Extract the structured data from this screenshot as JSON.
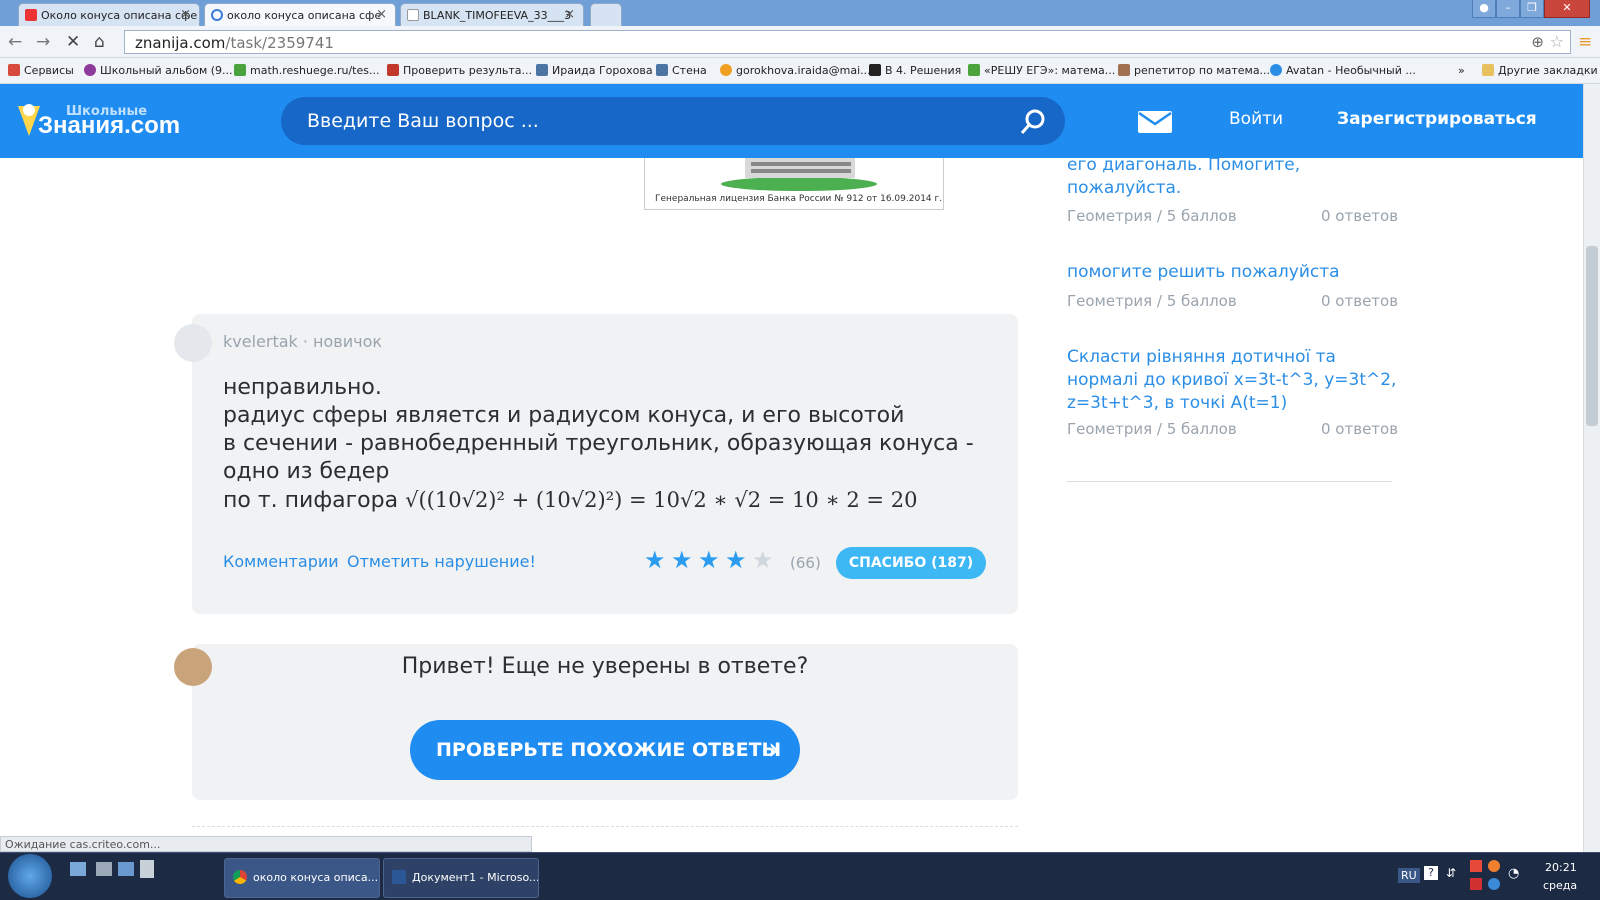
{
  "browser": {
    "tabs": [
      {
        "title": "Около конуса описана сфе"
      },
      {
        "title": "около конуса описана сфе"
      },
      {
        "title": "BLANK_TIMOFEEVA_33___3"
      }
    ],
    "close_glyph": "×",
    "url_domain": "znanija.com",
    "url_path": "/task/2359741",
    "bookmarks": [
      {
        "label": "Сервисы",
        "color": "#d64b3c"
      },
      {
        "label": "Школьный альбом (9...",
        "color": "#8e3a9a"
      },
      {
        "label": "math.reshuege.ru/tes...",
        "color": "#4aa33c"
      },
      {
        "label": "Проверить результа...",
        "color": "#c0392b"
      },
      {
        "label": "Ираида Горохова",
        "color": "#4c75a3"
      },
      {
        "label": "Стена",
        "color": "#4c75a3"
      },
      {
        "label": "gorokhova.iraida@mai...",
        "color": "#f0a020"
      },
      {
        "label": "В 4. Решения",
        "color": "#222222"
      },
      {
        "label": "«РЕШУ ЕГЭ»: матема...",
        "color": "#4aa33c"
      },
      {
        "label": "репетитор по матема...",
        "color": "#a07050"
      },
      {
        "label": "Avatan - Необычный ...",
        "color": "#2b8ee6"
      }
    ],
    "bookmarks_overflow": "»",
    "other_bookmarks": "Другие закладки",
    "status": "Ожидание cas.criteo.com..."
  },
  "site": {
    "logo_top": "Школьные",
    "logo_main": "Знания.com",
    "search_placeholder": "Введите Ваш вопрос ...",
    "login": "Войти",
    "register": "Зарегистрироваться",
    "ad_caption": "Генеральная лицензия Банка России  № 912 от 16.09.2014 г."
  },
  "answer": {
    "author": "kvelertak",
    "rank": " · новичок",
    "lines": [
      "неправильно.",
      "радиус сферы является и радиусом конуса, и его высотой",
      "в сечении - равнобедренный треугольник, образующая конуса -",
      "одно из бедер"
    ],
    "formula_prefix": "по т. пифагора",
    "formula": "√((10√2)² + (10√2)²) = 10√2 ∗ √2 = 10 ∗ 2 = 20",
    "comments": "Комментарии",
    "report": "Отметить нарушение!",
    "rating_stars": 4,
    "rating_count": "(66)",
    "thanks": "СПАСИБО (187)"
  },
  "helper": {
    "text": "Привет! Еще не уверены в ответе?",
    "button": "ПРОВЕРЬТЕ ПОХОЖИЕ ОТВЕТЫ",
    "arrow": "›"
  },
  "questions": [
    {
      "title": "его диагональ. Помогите, пожалуйста.",
      "subject": "Геометрия",
      "points": "5 баллов",
      "answers": "0 ответов"
    },
    {
      "title": "помогите решить пожалуйста",
      "subject": "Геометрия",
      "points": "5 баллов",
      "answers": "0 ответов"
    },
    {
      "title": "Скласти рівняння дотичної та нормалі до кривої x=3t-t^3, y=3t^2, z=3t+t^3, в точкі A(t=1)",
      "subject": "Геометрия",
      "points": "5 баллов",
      "answers": "0 ответов"
    }
  ],
  "question_sep": " / ",
  "taskbar": {
    "tasks": [
      "около конуса описа...",
      "Документ1 - Microso..."
    ],
    "lang": "RU",
    "time": "20:21",
    "day": "среда"
  }
}
